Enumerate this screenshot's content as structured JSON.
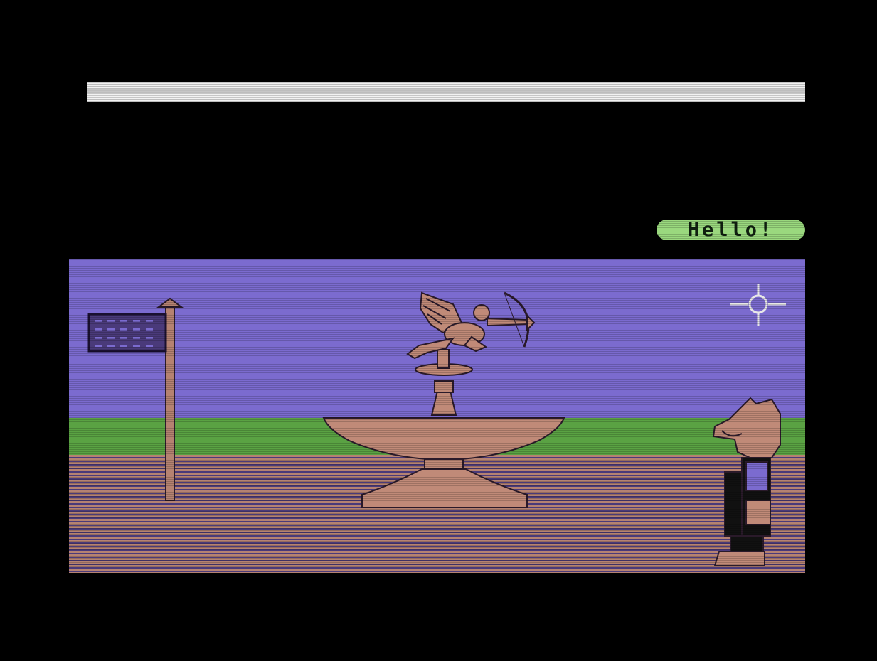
{
  "game": {
    "speech_bubble_text": "Hello!",
    "status_bar_text": "",
    "colors": {
      "sky": "#7b6bcf",
      "grass": "#5aa243",
      "ground": "#b58271",
      "statue": "#c08a78",
      "bubble": "#9ad87e",
      "status_bar": "#f2f2f2"
    },
    "icons": [
      "crosshair-cursor-icon",
      "flag-icon"
    ]
  }
}
